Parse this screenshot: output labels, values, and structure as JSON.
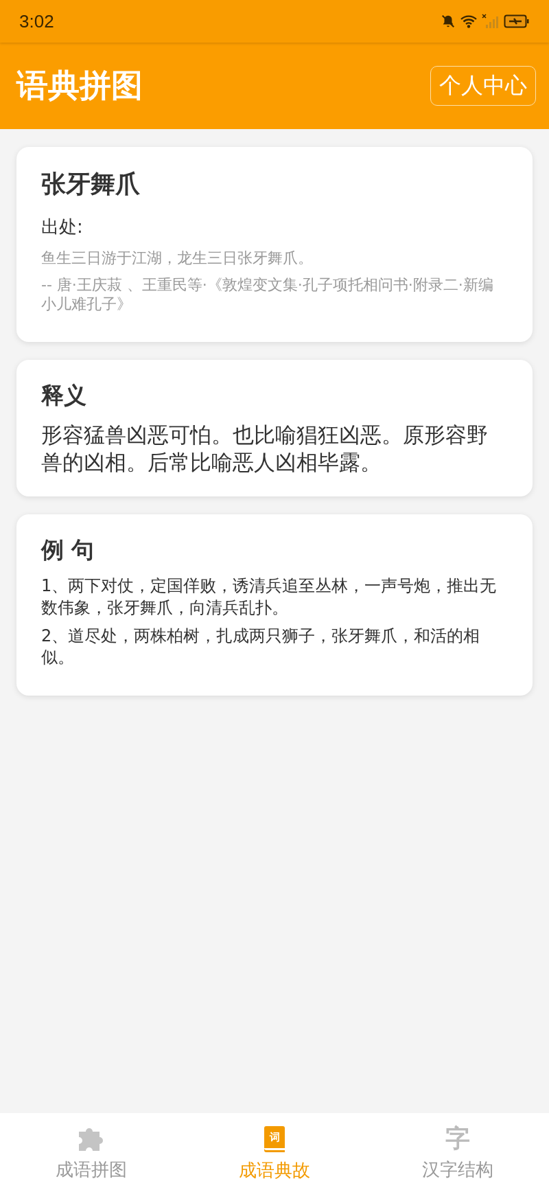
{
  "status_bar": {
    "time": "3:02"
  },
  "app_bar": {
    "title": "语典拼图",
    "action": "个人中心"
  },
  "idiom_card": {
    "title": "张牙舞爪",
    "source_label": "出处:",
    "quote": "鱼生三日游于江湖，龙生三日张牙舞爪。",
    "citation": "-- 唐·王庆菽 、王重民等·《敦煌变文集·孔子项托相问书·附录二·新编小儿难孔子》"
  },
  "meaning_card": {
    "title": "释义",
    "text": "形容猛兽凶恶可怕。也比喻猖狂凶恶。原形容野兽的凶相。后常比喻恶人凶相毕露。"
  },
  "examples_card": {
    "title": "例 句",
    "items": [
      "1、两下对仗，定国佯败，诱清兵追至丛林，一声号炮，推出无数伟象，张牙舞爪，向清兵乱扑。",
      "2、道尽处，两株柏树，扎成两只狮子，张牙舞爪，和活的相似。"
    ]
  },
  "tabs": [
    {
      "label": "成语拼图",
      "kind": "puzzle",
      "selected": false
    },
    {
      "label": "成语典故",
      "kind": "book",
      "glyph": "词",
      "selected": true
    },
    {
      "label": "汉字结构",
      "kind": "glyph",
      "glyph": "字",
      "selected": false
    }
  ]
}
